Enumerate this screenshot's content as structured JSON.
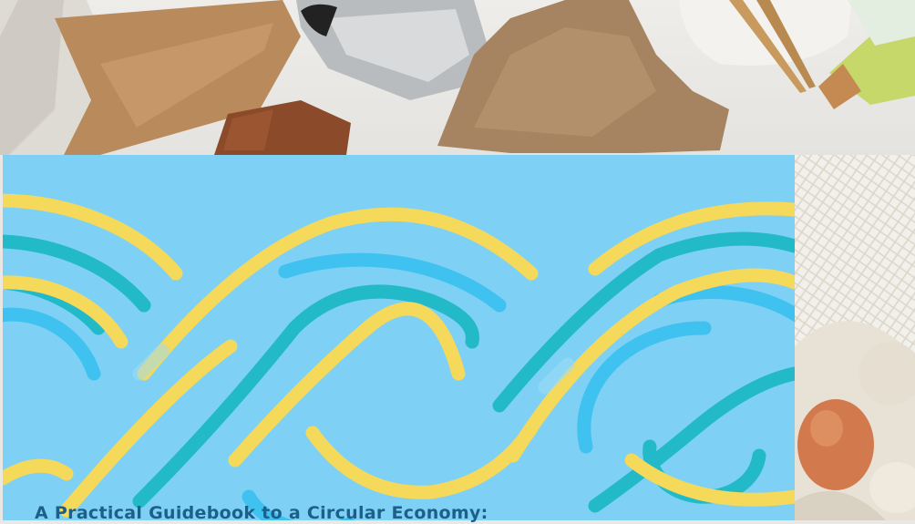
{
  "cover": {
    "title": "A Practical Guidebook to a Circular Economy:"
  },
  "colors": {
    "panel_background": "#7fd0f5",
    "wave_yellow": "#f5d95a",
    "wave_teal": "#22b9c9",
    "wave_light_blue": "#3fc2ef",
    "title_text": "#1b5f8a"
  },
  "images": {
    "top_photo": "zero-waste-items-photo",
    "right_photo": "mesh-bag-eggs-photo"
  }
}
